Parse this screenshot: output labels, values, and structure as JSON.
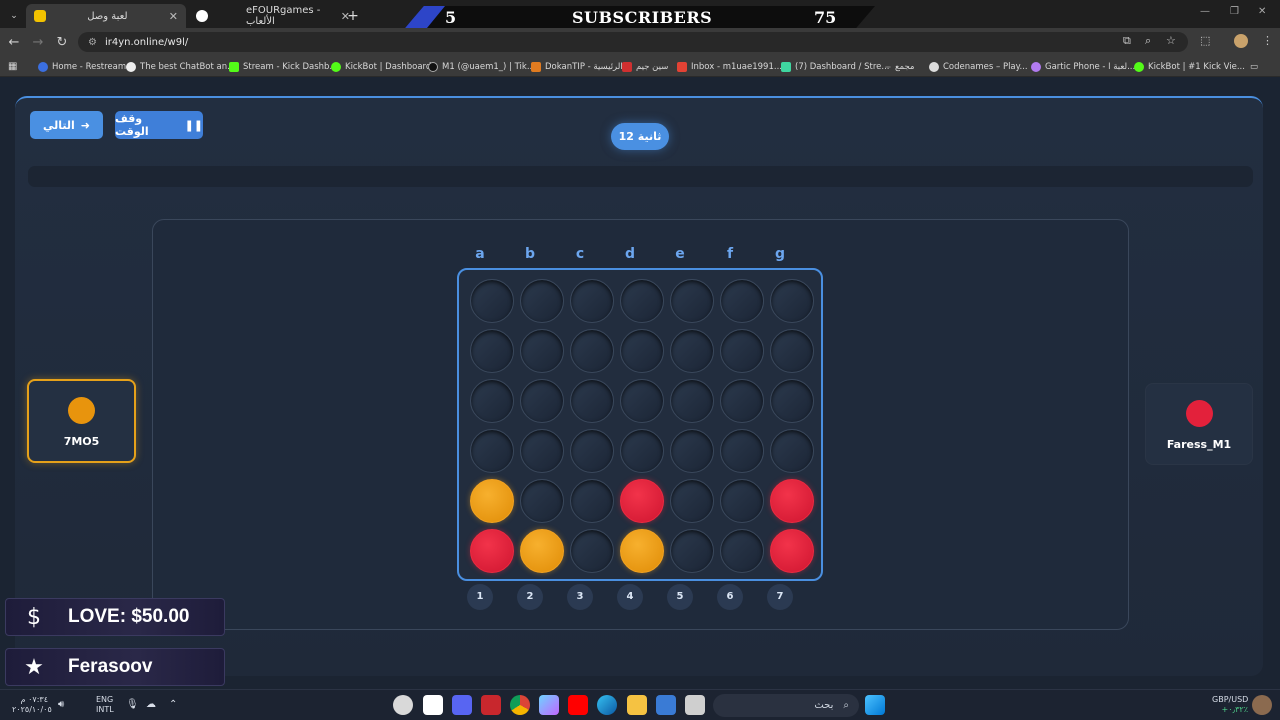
{
  "browser": {
    "tabs": [
      {
        "title": "لعبة وصل",
        "active": true
      },
      {
        "title": "eFOURgames - الألعاب",
        "active": false
      }
    ],
    "url": "ir4yn.online/w9l/",
    "bookmarks": [
      "Home - Restream",
      "The best ChatBot an...",
      "Stream - Kick Dashb...",
      "KickBot | Dashboard",
      "M1 (@uaem1_) | Tik...",
      "DokanTIP - الرئيسية",
      "سين جيم",
      "Inbox - m1uae1991...",
      "(7) Dashboard / Stre...",
      "مجمع",
      "Codenames – Play...",
      "Gartic Phone - لعبة ا...",
      "KickBot | #1 Kick Vie..."
    ]
  },
  "stream_banner": {
    "left_number": "5",
    "label": "SUBSCRIBERS",
    "right_number": "75"
  },
  "game": {
    "next_button": "التالي",
    "pause_button": "وقف الوقت",
    "timer": "12 ثانية",
    "progress": 0,
    "columns_letters": [
      "a",
      "b",
      "c",
      "d",
      "e",
      "f",
      "g"
    ],
    "columns_numbers": [
      "1",
      "2",
      "3",
      "4",
      "5",
      "6",
      "7"
    ],
    "board": [
      [
        "",
        "",
        "",
        "",
        "",
        "",
        ""
      ],
      [
        "",
        "",
        "",
        "",
        "",
        "",
        ""
      ],
      [
        "",
        "",
        "",
        "",
        "",
        "",
        ""
      ],
      [
        "",
        "",
        "",
        "",
        "",
        "",
        ""
      ],
      [
        "orange",
        "",
        "",
        "red",
        "",
        "",
        "red"
      ],
      [
        "red",
        "orange",
        "",
        "orange",
        "",
        "",
        "red"
      ]
    ],
    "player1": {
      "name": "7MO5",
      "color": "#e8940d",
      "active": true
    },
    "player2": {
      "name": "Faress_M1",
      "color": "#e3213b",
      "active": false
    }
  },
  "overlays": {
    "donation": "LOVE: $50.00",
    "follower": "Ferasoov"
  },
  "taskbar": {
    "search_label": "بحث",
    "time": "٠٧:٣٤ م",
    "date": "٢٠٢٥/١٠/٠٥",
    "lang_top": "ENG",
    "lang_bottom": "INTL",
    "ticker": "GBP/USD",
    "ticker_value": "+٠٫٣٢٪"
  }
}
